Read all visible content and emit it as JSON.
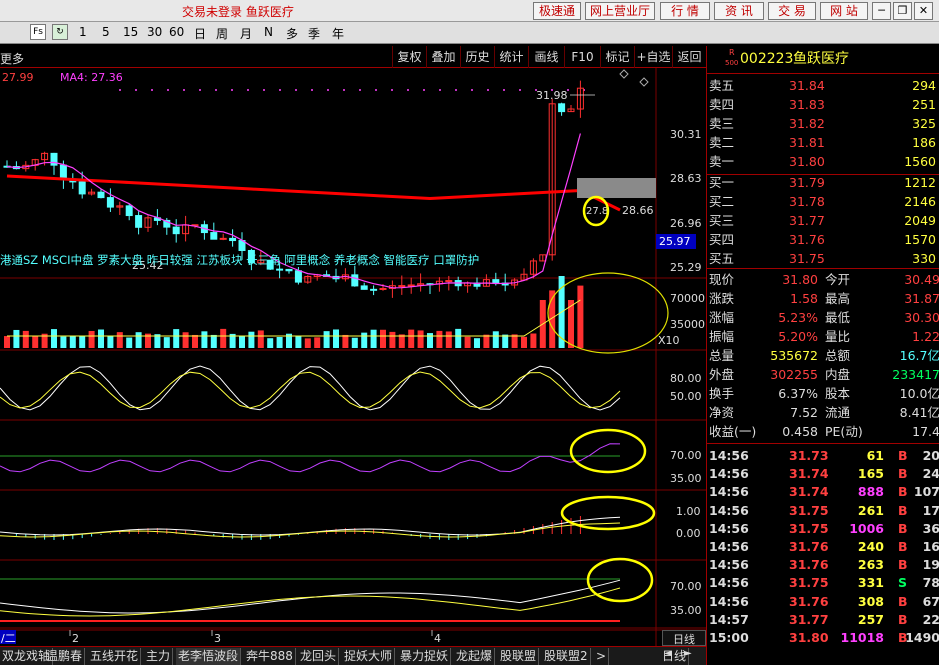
{
  "window": {
    "title": "交易未登录 鱼跃医疗",
    "buttons": [
      "极速通",
      "网上营业厅",
      "行 情",
      "资 讯",
      "交 易",
      "网 站"
    ]
  },
  "periods": {
    "items": [
      "1",
      "5",
      "15",
      "30",
      "60",
      "日",
      "周",
      "月",
      "N",
      "多",
      "季",
      "年"
    ],
    "fs": "Fs"
  },
  "toolbar": {
    "left": "更多",
    "items": [
      "复权",
      "叠加",
      "历史",
      "统计",
      "画线",
      "F10",
      "标记",
      "+自选",
      "返回"
    ]
  },
  "kline": {
    "ma_label": "27.99",
    "ma4_label": "MA4: 27.36",
    "price_axis": [
      "30.31",
      "28.63",
      "26.96",
      "25.29"
    ],
    "marker_high": "31.98",
    "marker_low": "25.42",
    "line_value": "28.66",
    "box_value": "27.8",
    "current_box": "25.97",
    "concepts": "港通SZ MSCI中盘 罗素大盘 昨日较强 江苏板块 长三角 阿里概念 养老概念 智能医疗 口罩防护"
  },
  "volume": {
    "axis": [
      "70000",
      "35000"
    ],
    "unit": "X10"
  },
  "ind1": {
    "axis": [
      "80.00",
      "50.00"
    ]
  },
  "ind2": {
    "axis": [
      "70.00",
      "35.00"
    ]
  },
  "ind3": {
    "axis": [
      "1.00",
      "0.00"
    ]
  },
  "ind4": {
    "axis": [
      "70.00",
      "35.00"
    ]
  },
  "dates": [
    "/二",
    "2",
    "3",
    "4"
  ],
  "bottom": {
    "tabs": [
      "双龙戏轴",
      "温鹏春",
      "五线开花",
      "主力",
      "老李悟波段",
      "奔牛888",
      "龙回头",
      "捉妖大师",
      "暴力捉妖",
      "龙起爆",
      "股联盟",
      "股联盟2"
    ],
    "right": "日线",
    "arrows": [
      ">",
      "◄",
      "►"
    ]
  },
  "quote": {
    "code": "002223",
    "name": "鱼跃医疗",
    "badge": "R",
    "badge_sub": "500",
    "asks": [
      {
        "l": "卖五",
        "p": "31.84",
        "v": "294"
      },
      {
        "l": "卖四",
        "p": "31.83",
        "v": "251"
      },
      {
        "l": "卖三",
        "p": "31.82",
        "v": "325"
      },
      {
        "l": "卖二",
        "p": "31.81",
        "v": "186"
      },
      {
        "l": "卖一",
        "p": "31.80",
        "v": "1560"
      }
    ],
    "bids": [
      {
        "l": "买一",
        "p": "31.79",
        "v": "1212"
      },
      {
        "l": "买二",
        "p": "31.78",
        "v": "2146"
      },
      {
        "l": "买三",
        "p": "31.77",
        "v": "2049"
      },
      {
        "l": "买四",
        "p": "31.76",
        "v": "1570"
      },
      {
        "l": "买五",
        "p": "31.75",
        "v": "330"
      }
    ],
    "stats": [
      {
        "l1": "现价",
        "v1": "31.80",
        "l2": "今开",
        "v2": "30.49"
      },
      {
        "l1": "涨跌",
        "v1": "1.58",
        "l2": "最高",
        "v2": "31.87"
      },
      {
        "l1": "涨幅",
        "v1": "5.23%",
        "l2": "最低",
        "v2": "30.30"
      },
      {
        "l1": "振幅",
        "v1": "5.20%",
        "l2": "量比",
        "v2": "1.22"
      },
      {
        "l1": "总量",
        "v1": "535672",
        "l2": "总额",
        "v2": "16.7亿"
      },
      {
        "l1": "外盘",
        "v1": "302255",
        "l2": "内盘",
        "v2": "233417"
      },
      {
        "l1": "换手",
        "v1": "6.37%",
        "l2": "股本",
        "v2": "10.0亿"
      },
      {
        "l1": "净资",
        "v1": "7.52",
        "l2": "流通",
        "v2": "8.41亿"
      },
      {
        "l1": "收益(一)",
        "v1": "0.458",
        "l2": "PE(动)",
        "v2": "17.4"
      }
    ],
    "ticks": [
      {
        "t": "14:56",
        "p": "31.73",
        "v": "61",
        "d": "B",
        "n": "20"
      },
      {
        "t": "14:56",
        "p": "31.74",
        "v": "165",
        "d": "B",
        "n": "24"
      },
      {
        "t": "14:56",
        "p": "31.74",
        "v": "888",
        "d": "B",
        "n": "107"
      },
      {
        "t": "14:56",
        "p": "31.75",
        "v": "261",
        "d": "B",
        "n": "17"
      },
      {
        "t": "14:56",
        "p": "31.75",
        "v": "1006",
        "d": "B",
        "n": "36"
      },
      {
        "t": "14:56",
        "p": "31.76",
        "v": "240",
        "d": "B",
        "n": "16"
      },
      {
        "t": "14:56",
        "p": "31.76",
        "v": "263",
        "d": "B",
        "n": "19"
      },
      {
        "t": "14:56",
        "p": "31.75",
        "v": "331",
        "d": "S",
        "n": "78"
      },
      {
        "t": "14:56",
        "p": "31.76",
        "v": "308",
        "d": "B",
        "n": "67"
      },
      {
        "t": "14:57",
        "p": "31.77",
        "v": "257",
        "d": "B",
        "n": "22"
      },
      {
        "t": "15:00",
        "p": "31.80",
        "v": "11018",
        "d": "B",
        "n": "1490"
      }
    ]
  },
  "colors": {
    "up": "#ff3030",
    "down": "#54ffff",
    "ma_main": "#ff0000",
    "ma_sub": "#ff40ff",
    "price": "#ff4040",
    "vol": "#ffff40",
    "grid": "#7a0000",
    "circle": "#ffff00"
  }
}
